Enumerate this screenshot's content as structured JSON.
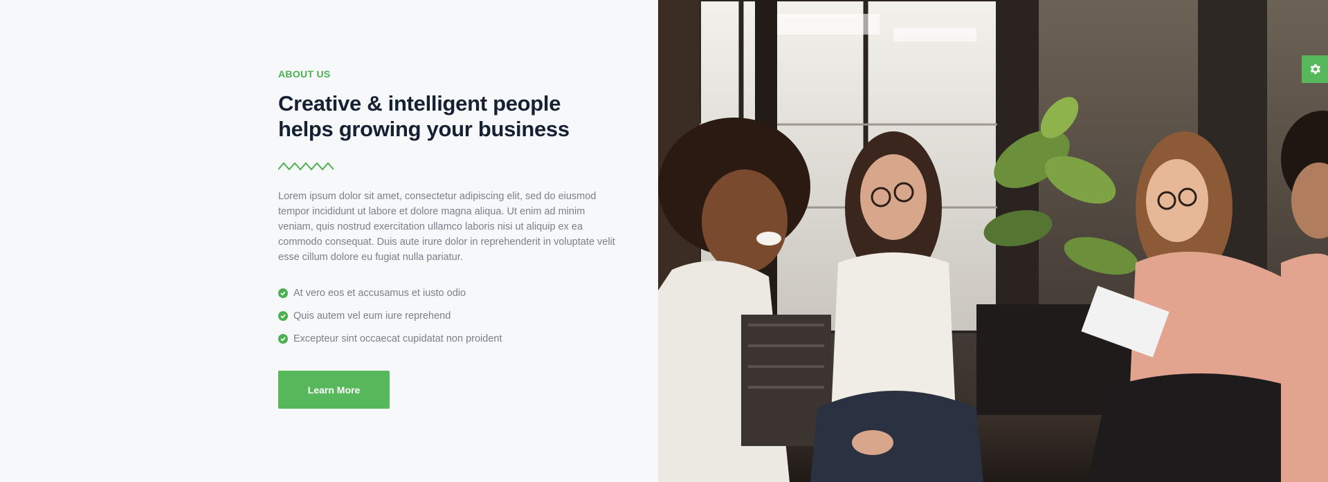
{
  "about": {
    "eyebrow": "ABOUT US",
    "title": "Creative & intelligent people helps growing your business",
    "paragraph": "Lorem ipsum dolor sit amet, consectetur adipiscing elit, sed do eiusmod tempor incididunt ut labore et dolore magna aliqua. Ut enim ad minim veniam, quis nostrud exercitation ullamco laboris nisi ut aliquip ex ea commodo consequat. Duis aute irure dolor in reprehenderit in voluptate velit esse cillum dolore eu fugiat nulla pariatur.",
    "checklist": [
      "At vero eos et accusamus et iusto odio",
      "Quis autem vel eum iure reprehend",
      "Excepteur sint occaecat cupidatat non proident"
    ],
    "button_label": "Learn More"
  },
  "image": {
    "icon": "team-photo"
  },
  "settings": {
    "icon": "gear-icon"
  },
  "colors": {
    "accent": "#57b85b",
    "heading": "#152033",
    "body_text": "#7a7f88",
    "background": "#f7f8fa"
  }
}
